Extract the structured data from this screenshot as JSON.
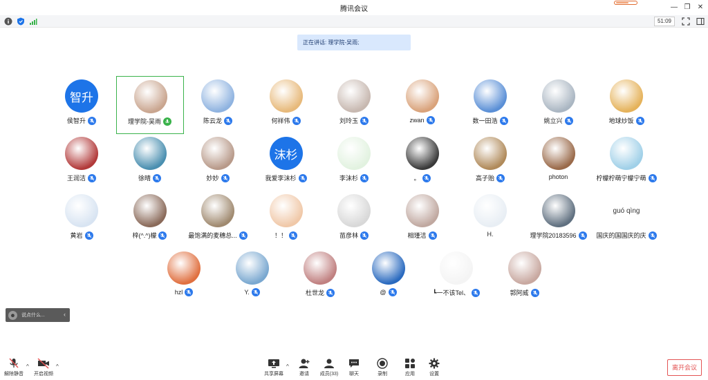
{
  "window": {
    "title": "腾讯会议"
  },
  "status": {
    "timer": "51:09"
  },
  "speaking": {
    "label": "正在讲话: 理学院-吴雨;"
  },
  "participants": [
    {
      "name": "侯智升",
      "avatar_text": "智升"
    },
    {
      "name": "理学院-吴雨",
      "speaking": true
    },
    {
      "name": "陈云龙"
    },
    {
      "name": "何祥伟"
    },
    {
      "name": "刘玲玉"
    },
    {
      "name": "zwan"
    },
    {
      "name": "数一田浩"
    },
    {
      "name": "姚立兴"
    },
    {
      "name": "地球炒饭"
    },
    {
      "name": "王润洁"
    },
    {
      "name": "徐晴"
    },
    {
      "name": "妙妙"
    },
    {
      "name": "我爱李沫杉",
      "avatar_text": "沫杉"
    },
    {
      "name": "李沫杉"
    },
    {
      "name": "。"
    },
    {
      "name": "高子贻"
    },
    {
      "name": "photon"
    },
    {
      "name": "柠檬柠萌宁檬宁萌"
    },
    {
      "name": "黄岩"
    },
    {
      "name": "梓(^.^)檬"
    },
    {
      "name": "最饱满的麦穗总..."
    },
    {
      "name": "！！"
    },
    {
      "name": "苗彦林"
    },
    {
      "name": "相瑾洁"
    },
    {
      "name": "H."
    },
    {
      "name": "理学院20183596"
    },
    {
      "name": "国庆的国国庆的庆",
      "avatar_text": "guó qìng"
    },
    {
      "name": "hzl"
    },
    {
      "name": "Y."
    },
    {
      "name": "杜世龙"
    },
    {
      "name": "@"
    },
    {
      "name": "┗一不该Tel、"
    },
    {
      "name": "郭阿威"
    }
  ],
  "chat": {
    "placeholder": "说点什么..."
  },
  "toolbar": {
    "unmute": "解除静音",
    "start_video": "开启视频",
    "share": "共享屏幕",
    "invite": "邀请",
    "members": "成员(33)",
    "chat": "聊天",
    "record": "录制",
    "apps": "应用",
    "settings": "设置",
    "leave": "离开会议"
  },
  "colors": {
    "accent": "#2c79ec",
    "speaking_border": "#39b24a",
    "leave": "#e35353"
  }
}
